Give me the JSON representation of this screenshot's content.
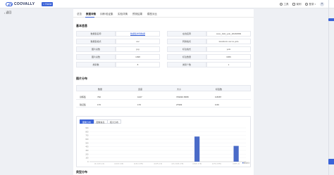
{
  "header": {
    "logo_text": "COOVALLY",
    "home_button": "Home",
    "tools": "工具",
    "help": "案例",
    "user": "登录"
  },
  "back_label": "返回",
  "tabs": [
    "总览",
    "数据详情",
    "训练/验证集",
    "实验详情",
    "预测结果",
    "模型对比"
  ],
  "active_tab_index": 1,
  "basic_info": {
    "title": "基本信息",
    "rows": [
      {
        "l1": "数据集名称",
        "v1": "数据集样例数据",
        "l2": "在线名称",
        "v2": "coco_bdd_yolo_20240809"
      },
      {
        "l1": "数据集格式",
        "v1": "voc",
        "l2": "转换格式",
        "v2": "transform voc to yolo"
      },
      {
        "l1": "图片总数",
        "v1": "jpg",
        "l2": "标注格式",
        "v2": "yolo"
      },
      {
        "l1": "图片总数",
        "v1": "1098",
        "l2": "标注数量",
        "v2": "3366"
      },
      {
        "l1": "类别数",
        "v1": "8",
        "l2": "类别个数",
        "v2": "1"
      }
    ]
  },
  "image_dist": {
    "title": "图片分布",
    "headers": [
      "数量",
      "宽度",
      "大小",
      "标签数"
    ],
    "rows": [
      {
        "name": "训练集",
        "c1": "790",
        "c2": "1027",
        "c3": "709030.6588",
        "c4": "0.8087"
      },
      {
        "name": "验证集",
        "c1": "170",
        "c2": "170",
        "c3": "27903",
        "c4": "0.66"
      }
    ]
  },
  "chart_tabs": [
    "图像分布",
    "图像信息",
    "框大分布"
  ],
  "chart_data": {
    "type": "bar",
    "categories": [
      "(0, 0.125, 0.2]",
      "(0.125, 0.25]",
      "(0.25, 0.375]",
      "(0.375, 0.5]",
      "(0.5, 0.625, 0.75]",
      "(0.625, 0.75]",
      "(0.75, 0.875]",
      "(0.875, 1]"
    ],
    "values": [
      0,
      0,
      0,
      0,
      0,
      670,
      0,
      420
    ],
    "ylim": [
      0,
      900
    ],
    "yticks": [
      0,
      100,
      200,
      300,
      400,
      500,
      600,
      700,
      800,
      900
    ],
    "bar_color": "#4a6bc8",
    "legend_label": "数量统计"
  },
  "next_section": "类型分布"
}
